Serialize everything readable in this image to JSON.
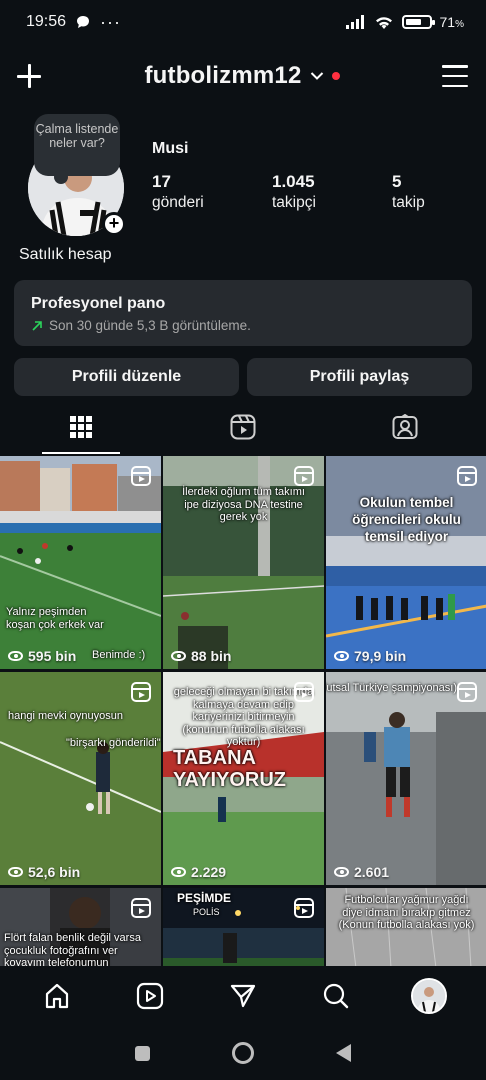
{
  "status_bar": {
    "time": "19:56",
    "battery": "71",
    "battery_unit": "%",
    "battery_level": 0.71
  },
  "header": {
    "username": "futbolizmm12"
  },
  "profile": {
    "note": "Çalma listende neler var?",
    "display_name": "Musi",
    "bio": "Satılık hesap",
    "stats": [
      {
        "value": "17",
        "label": "gönderi"
      },
      {
        "value": "1.045",
        "label": "takipçi"
      },
      {
        "value": "5",
        "label": "takip"
      }
    ]
  },
  "dashboard": {
    "title": "Profesyonel pano",
    "subtitle": "Son 30 günde 5,3 B görüntüleme."
  },
  "buttons": {
    "edit": "Profili düzenle",
    "share": "Profili paylaş"
  },
  "posts": [
    {
      "views": "595 bin",
      "caption_1": "Yalnız peşimden koşan çok erkek var",
      "caption_2": "Benimde :)"
    },
    {
      "views": "88 bin",
      "caption_1": "İlerdeki oğlum tüm takımı ipe diziyosa DNA testine gerek yok"
    },
    {
      "views": "79,9 bin",
      "caption_1": "Okulun tembel öğrencileri okulu temsil ediyor"
    },
    {
      "views": "52,6 bin",
      "caption_1": "hangi mevki oynuyosun",
      "caption_2": "\"birşarkı gönderildi\""
    },
    {
      "views": "2.229",
      "caption_1": "geleceği olmayan bi takımda kalmaya devam edip kariyerinizi bitirmeyin (konunun futbolla alakası yoktur)",
      "banner": "TABANA YAYIYORUZ"
    },
    {
      "views": "2.601",
      "caption_1": "(Futsal Türkiye şampiyonası)"
    },
    {
      "caption_1": "Flört falan benlik değil varsa çocukluk fotoğrafını ver koyayım telefonumun"
    },
    {
      "caption_1": "PEŞİMDE",
      "caption_2": "POLİS"
    },
    {
      "caption_1": "Futbolcular yağmur yağdı diye idmanı bırakıp gitmez (Konun futbolla alakası yok)"
    }
  ]
}
